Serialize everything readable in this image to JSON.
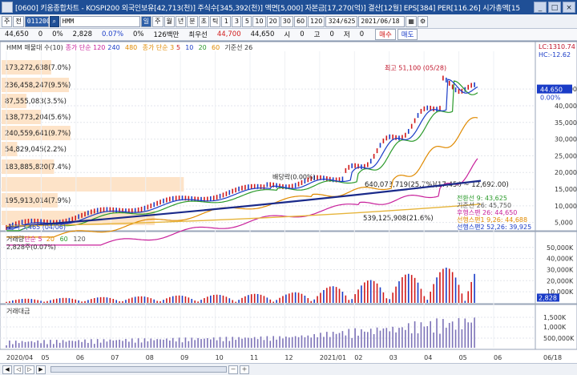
{
  "window": {
    "title": "[0600] 키움종합차트 - KOSPI200 외국인보유[42,713(천)] 주식수[345,392(천)] 액면[5,000] 자본금[17,270(억)] 결산[12월] EPS[384] PER[116.26] 시가총액[15",
    "buttons": [
      "_",
      "□",
      "×"
    ]
  },
  "toolbar": {
    "mode_a": "주",
    "mode_b": "전",
    "stock_code": "011200",
    "search_icon": "⌕",
    "stock_name": "HMM",
    "cycles": [
      "일",
      "주",
      "월",
      "년",
      "분",
      "초",
      "틱"
    ],
    "minutes": [
      "1",
      "3",
      "5",
      "10",
      "20",
      "30",
      "60",
      "120"
    ],
    "count": "324/625",
    "date": "2021/06/18"
  },
  "quote": {
    "price": "44,650",
    "change": "0",
    "change_pct": "0%",
    "volume": "2,828",
    "vol_pct": "0.07%",
    "vol_pct2": "0%",
    "turnover": "126백만",
    "high_label": "최우선",
    "ask": "44,700",
    "bid": "44,650",
    "open_label": "시",
    "open": "0",
    "hi_label": "고",
    "hi": "0",
    "lo_label": "저",
    "lo": "0",
    "buy": "매수",
    "sell": "매도"
  },
  "price_panel": {
    "legend": [
      {
        "text": "HMM 매물대 수(10)",
        "color": "#333333"
      },
      {
        "text": "종가 단순 120",
        "color": "#c8209b"
      },
      {
        "text": "240",
        "color": "#1a3cc7"
      },
      {
        "text": "480",
        "color": "#e08a00"
      },
      {
        "text": "종가 단순 3",
        "color": "#e08a00"
      },
      {
        "text": "5",
        "color": "#d01919"
      },
      {
        "text": "10",
        "color": "#1a3cc7"
      },
      {
        "text": "20",
        "color": "#2a9a2a"
      },
      {
        "text": "60",
        "color": "#e08a00"
      },
      {
        "text": "기준선 26",
        "color": "#333333"
      }
    ],
    "volume_profile": [
      {
        "label": "173,272,638(7.0%)",
        "pct": 7.0
      },
      {
        "label": "236,458,247(9.5%)",
        "pct": 9.5
      },
      {
        "label": "87,555,083(3.5%)",
        "pct": 3.5
      },
      {
        "label": "138,773,204(5.6%)",
        "pct": 5.6
      },
      {
        "label": "240,559,641(9.7%)",
        "pct": 9.7
      },
      {
        "label": "54,829,045(2.2%)",
        "pct": 2.2
      },
      {
        "label": "183,885,820(7.4%)",
        "pct": 7.4
      },
      {
        "label": "640,073,719(25.7%)(17,450 ~ 12,692.00)",
        "pct": 25.7
      },
      {
        "label": "195,913,014(7.9%)",
        "pct": 7.9
      },
      {
        "label": "539,125,908(21.6%)",
        "pct": 21.6
      }
    ],
    "annotations": {
      "high": "최고 51,100 (05/28)",
      "low": "최저 3,465 (04/06)",
      "dividend": "배당락(0.00%)",
      "lc": "LC:1310.74",
      "hc": "HC:-12.62"
    },
    "current_price": "44.650",
    "current_pct": "0.00%",
    "y_axis": [
      "45,000",
      "40,000",
      "35,000",
      "30,000",
      "25,000",
      "20,000",
      "15,000",
      "10,000",
      "5,000"
    ],
    "indicators": [
      {
        "label": "전환선 9: 43,625",
        "color": "#2a9a2a"
      },
      {
        "label": "기준선 26: 45,750",
        "color": "#555555"
      },
      {
        "label": "후행스팬 26: 44,650",
        "color": "#c8209b"
      },
      {
        "label": "선행스팬1 9,26: 44,688",
        "color": "#e08a00"
      },
      {
        "label": "선행스팬2 52,26: 39,925",
        "color": "#1a3cc7"
      }
    ]
  },
  "volume_panel": {
    "legend": [
      {
        "text": "거래량",
        "color": "#333333"
      },
      {
        "text": "단순 5",
        "color": "#c8209b"
      },
      {
        "text": "20",
        "color": "#e08a00"
      },
      {
        "text": "60",
        "color": "#2a9a2a"
      },
      {
        "text": "120",
        "color": "#555555"
      }
    ],
    "sub": "2,828주(0.07%)",
    "y_axis": [
      "50,000K",
      "40,000K",
      "30,000K",
      "20,000K",
      "10,000K"
    ],
    "marker": "2,828"
  },
  "amount_panel": {
    "legend": "거래대금",
    "y_axis": [
      "1,500K",
      "1,000K",
      "500,000K"
    ]
  },
  "x_axis": [
    "2020/04",
    "05",
    "06",
    "07",
    "08",
    "09",
    "10",
    "11",
    "12",
    "2021/01",
    "02",
    "03",
    "04",
    "05",
    "06",
    "06/18"
  ],
  "colors": {
    "up": "#d01919",
    "down": "#1a3cc7",
    "profile": "#fde3c8",
    "titlebar": "#1f4f96"
  }
}
